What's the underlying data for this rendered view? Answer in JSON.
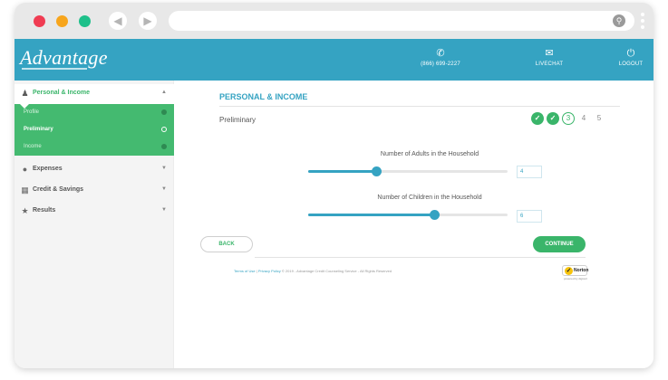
{
  "header": {
    "logo": "Advantage",
    "phone": "(866) 699-2227",
    "chat_label": "LIVECHAT",
    "logout_label": "LOGOUT"
  },
  "sidebar": {
    "sections": [
      {
        "label": "Personal & Income",
        "icon": "people-icon",
        "expanded": true
      },
      {
        "label": "Expenses",
        "icon": "dollar-icon",
        "expanded": false
      },
      {
        "label": "Credit & Savings",
        "icon": "bank-icon",
        "expanded": false
      },
      {
        "label": "Results",
        "icon": "star-icon",
        "expanded": false
      }
    ],
    "subitems": [
      {
        "label": "Profile",
        "status": "complete"
      },
      {
        "label": "Preliminary",
        "status": "current"
      },
      {
        "label": "Income",
        "status": "complete"
      }
    ]
  },
  "main": {
    "title": "PERSONAL & INCOME",
    "step_name": "Preliminary",
    "steps": [
      "✓",
      "✓",
      "3",
      "4",
      "5"
    ],
    "adults": {
      "label": "Number of Adults in the Household",
      "value": "4",
      "level": 0.34
    },
    "children": {
      "label": "Number of Children in the Household",
      "value": "6",
      "level": 0.63
    },
    "back_label": "BACK",
    "continue_label": "CONTINUE"
  },
  "footer": {
    "terms": "Terms of Use",
    "privacy": "Privacy Policy",
    "copyright": "© 2019 - Advantage Credit Counseling Service - All Rights Reserved",
    "badge": "Norton",
    "badge_sub": "powered by digicert"
  },
  "colors": {
    "accent": "#35a3c2",
    "green": "#3ab56a"
  }
}
